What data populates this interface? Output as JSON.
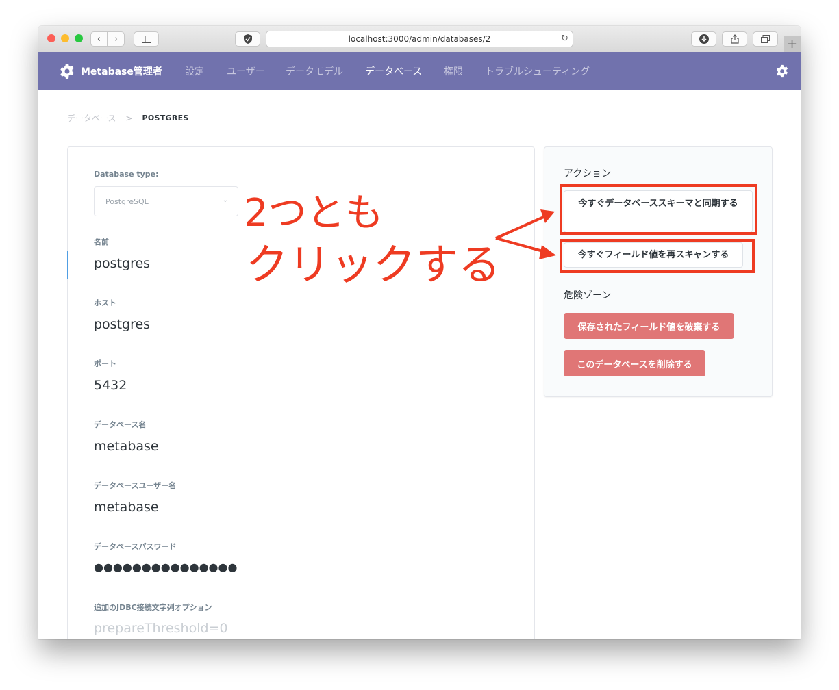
{
  "browser": {
    "url": "localhost:3000/admin/databases/2",
    "icons": [
      "back-icon",
      "forward-icon",
      "sidebar-icon",
      "shield-icon",
      "reload-icon",
      "download-icon",
      "share-icon",
      "tabs-icon",
      "new-tab-icon"
    ]
  },
  "nav": {
    "brand": "Metabase管理者",
    "links": [
      "設定",
      "ユーザー",
      "データモデル",
      "データベース",
      "権限",
      "トラブルシューティング"
    ],
    "active": "データベース"
  },
  "breadcrumb": {
    "parent": "データベース",
    "current": "POSTGRES"
  },
  "form": {
    "db_type_label": "Database type:",
    "db_type_value": "PostgreSQL",
    "fields": [
      {
        "label": "名前",
        "value": "postgres"
      },
      {
        "label": "ホスト",
        "value": "postgres"
      },
      {
        "label": "ポート",
        "value": "5432"
      },
      {
        "label": "データベース名",
        "value": "metabase"
      },
      {
        "label": "データベースユーザー名",
        "value": "metabase"
      },
      {
        "label": "データベースパスワード",
        "value": "●●●●●●●●●●●●●●●"
      },
      {
        "label": "追加のJDBC接続文字列オプション",
        "value": "prepareThreshold=0"
      }
    ]
  },
  "actions": {
    "title": "アクション",
    "sync_button": "今すぐデータベーススキーマと同期する",
    "rescan_button": "今すぐフィールド値を再スキャンする"
  },
  "danger": {
    "title": "危険ゾーン",
    "discard_button": "保存されたフィールド値を破棄する",
    "delete_button": "このデータベースを削除する"
  },
  "annotation": {
    "line1": "2つとも",
    "line2": "クリックする",
    "color": "#ee3b22"
  }
}
